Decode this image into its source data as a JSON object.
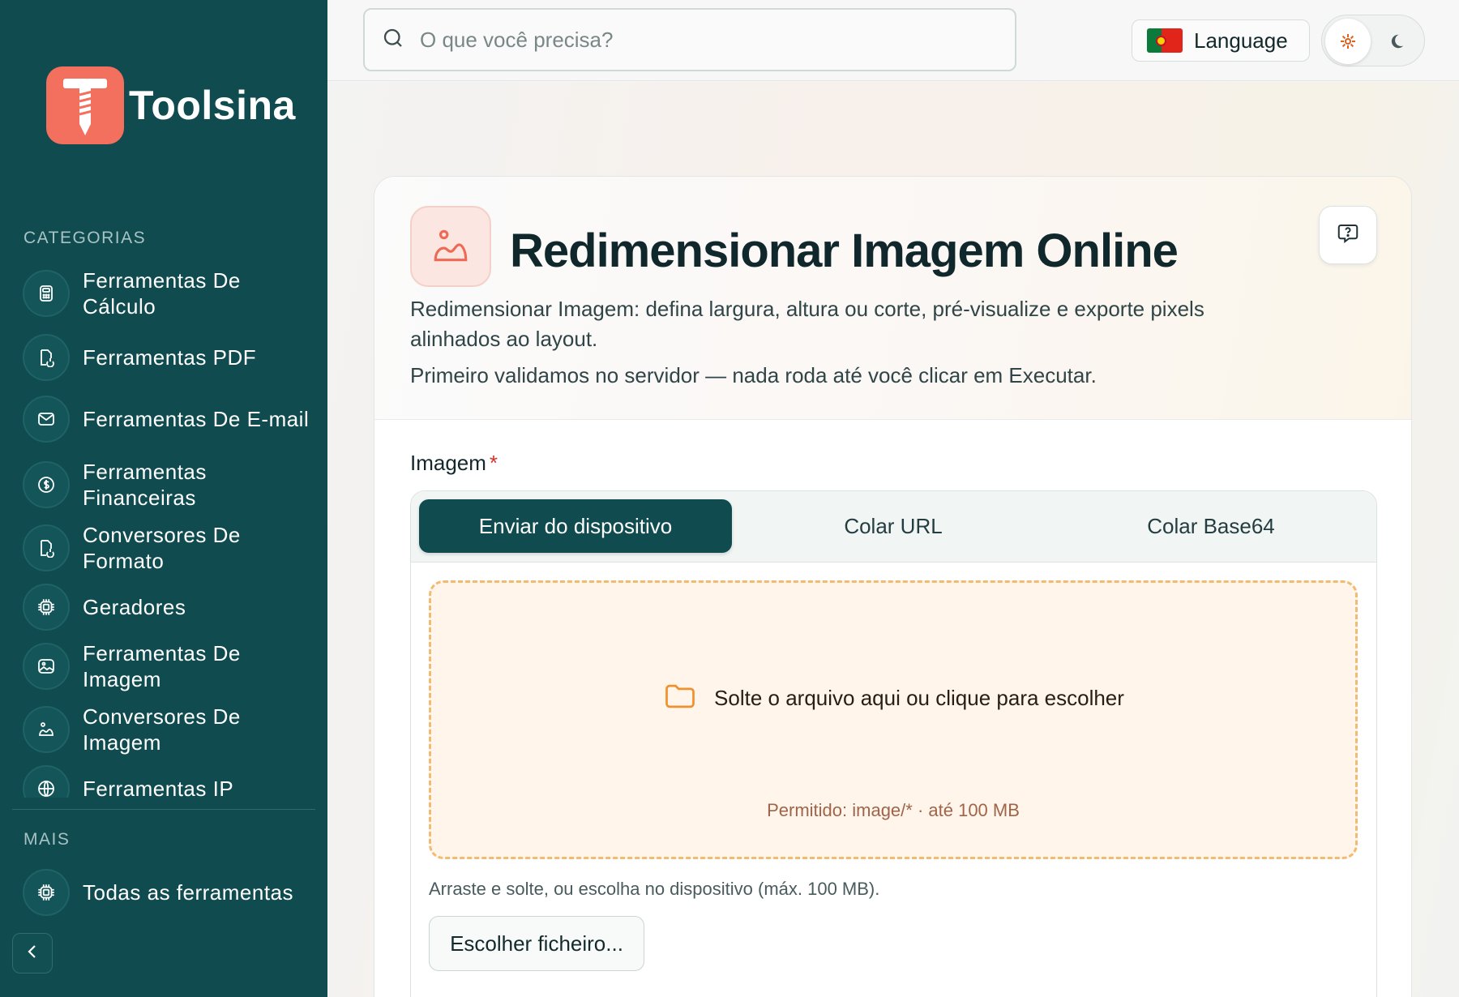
{
  "brand": {
    "name": "Toolsina"
  },
  "sidebar": {
    "categories_title": "CATEGORIAS",
    "items": [
      {
        "label": "Ferramentas De Cálculo",
        "icon": "calculator-icon"
      },
      {
        "label": "Ferramentas PDF",
        "icon": "pdf-icon"
      },
      {
        "label": "Ferramentas De E-mail",
        "icon": "mail-icon"
      },
      {
        "label": "Ferramentas Financeiras",
        "icon": "dollar-icon"
      },
      {
        "label": "Conversores De Formato",
        "icon": "convert-icon"
      },
      {
        "label": "Geradores",
        "icon": "chip-icon"
      },
      {
        "label": "Ferramentas De Imagem",
        "icon": "image-icon"
      },
      {
        "label": "Conversores De Imagem",
        "icon": "image-convert-icon"
      },
      {
        "label": "Ferramentas IP",
        "icon": "globe-icon"
      }
    ],
    "more_title": "MAIS",
    "more_items": [
      {
        "label": "Todas as ferramentas",
        "icon": "chip-icon"
      }
    ]
  },
  "topbar": {
    "search_placeholder": "O que você precisa?",
    "language_label": "Language"
  },
  "tool": {
    "title": "Redimensionar Imagem Online",
    "description": "Redimensionar Imagem: defina largura, altura ou corte, pré-visualize e exporte pixels alinhados ao layout.",
    "note": "Primeiro validamos no servidor — nada roda até você clicar em Executar.",
    "field_label": "Imagem",
    "required_mark": "*",
    "tabs": [
      "Enviar do dispositivo",
      "Colar URL",
      "Colar Base64"
    ],
    "dropzone_text": "Solte o arquivo aqui ou clique para escolher",
    "dropzone_allowed": "Permitido: image/* · até 100 MB",
    "hint": "Arraste e solte, ou escolha no dispositivo (máx. 100 MB).",
    "choose_button": "Escolher ficheiro..."
  },
  "colors": {
    "sidebar_bg": "#0f4b4f",
    "brand_accent": "#f36f5e",
    "dropzone_border": "#f2bb72"
  }
}
